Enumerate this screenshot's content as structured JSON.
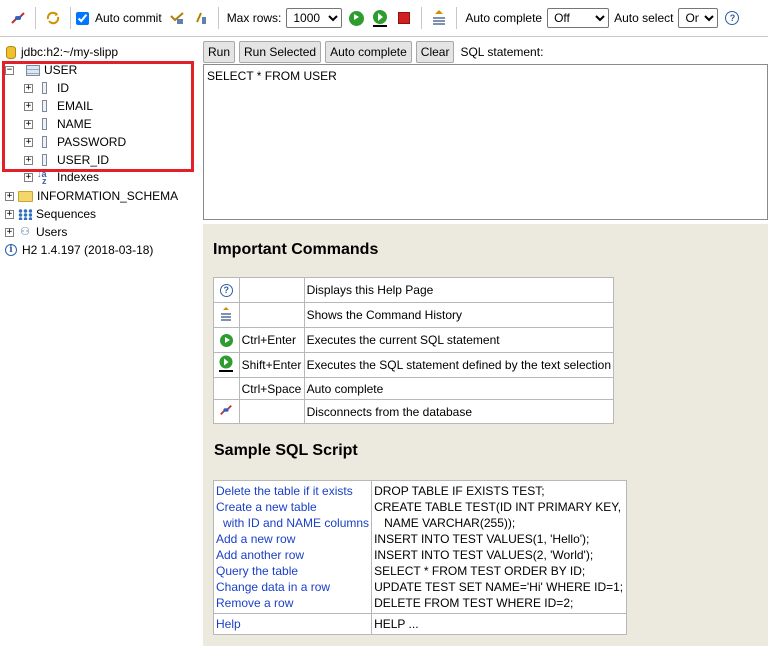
{
  "toolbar": {
    "icons": [
      "disconnect-icon",
      "refresh-icon",
      "commit-icon",
      "rollback-icon",
      "run-icon",
      "run-selected-icon",
      "stop-icon",
      "history-icon",
      "help-icon"
    ],
    "auto_commit_label": "Auto commit",
    "auto_commit_checked": true,
    "max_rows_label": "Max rows:",
    "max_rows_value": "1000",
    "auto_complete_label": "Auto complete",
    "auto_complete_value": "Off",
    "auto_select_label": "Auto select",
    "auto_select_value": "On"
  },
  "tree": {
    "connection": "jdbc:h2:~/my-slipp",
    "table": "USER",
    "columns": [
      "ID",
      "EMAIL",
      "NAME",
      "PASSWORD",
      "USER_ID"
    ],
    "indexes": "Indexes",
    "schema": "INFORMATION_SCHEMA",
    "sequences": "Sequences",
    "users": "Users",
    "version": "H2 1.4.197 (2018-03-18)"
  },
  "sql_panel": {
    "buttons": [
      "Run",
      "Run Selected",
      "Auto complete",
      "Clear"
    ],
    "label": "SQL statement:",
    "statement": "SELECT * FROM USER"
  },
  "help": {
    "important_title": "Important Commands",
    "commands": [
      {
        "icon": "help-icon",
        "key": "",
        "desc": "Displays this Help Page"
      },
      {
        "icon": "history-icon",
        "key": "",
        "desc": "Shows the Command History"
      },
      {
        "icon": "run-icon",
        "key": "Ctrl+Enter",
        "desc": "Executes the current SQL statement"
      },
      {
        "icon": "run-selected-icon",
        "key": "Shift+Enter",
        "desc": "Executes the SQL statement defined by the text selection"
      },
      {
        "icon": "",
        "key": "Ctrl+Space",
        "desc": "Auto complete"
      },
      {
        "icon": "disconnect-icon",
        "key": "",
        "desc": "Disconnects from the database"
      }
    ],
    "sample_title": "Sample SQL Script",
    "samples": [
      {
        "links": [
          "Delete the table if it exists"
        ],
        "sql": [
          "DROP TABLE IF EXISTS TEST;"
        ]
      },
      {
        "links": [
          "Create a new table",
          "with ID and NAME columns"
        ],
        "sql": [
          "CREATE TABLE TEST(ID INT PRIMARY KEY,",
          "NAME VARCHAR(255));"
        ]
      },
      {
        "links": [
          "Add a new row"
        ],
        "sql": [
          "INSERT INTO TEST VALUES(1, 'Hello');"
        ]
      },
      {
        "links": [
          "Add another row"
        ],
        "sql": [
          "INSERT INTO TEST VALUES(2, 'World');"
        ]
      },
      {
        "links": [
          "Query the table"
        ],
        "sql": [
          "SELECT * FROM TEST ORDER BY ID;"
        ]
      },
      {
        "links": [
          "Change data in a row"
        ],
        "sql": [
          "UPDATE TEST SET NAME='Hi' WHERE ID=1;"
        ]
      },
      {
        "links": [
          "Remove a row"
        ],
        "sql": [
          "DELETE FROM TEST WHERE ID=2;"
        ]
      }
    ],
    "help_link": "Help",
    "help_sql": "HELP ..."
  }
}
